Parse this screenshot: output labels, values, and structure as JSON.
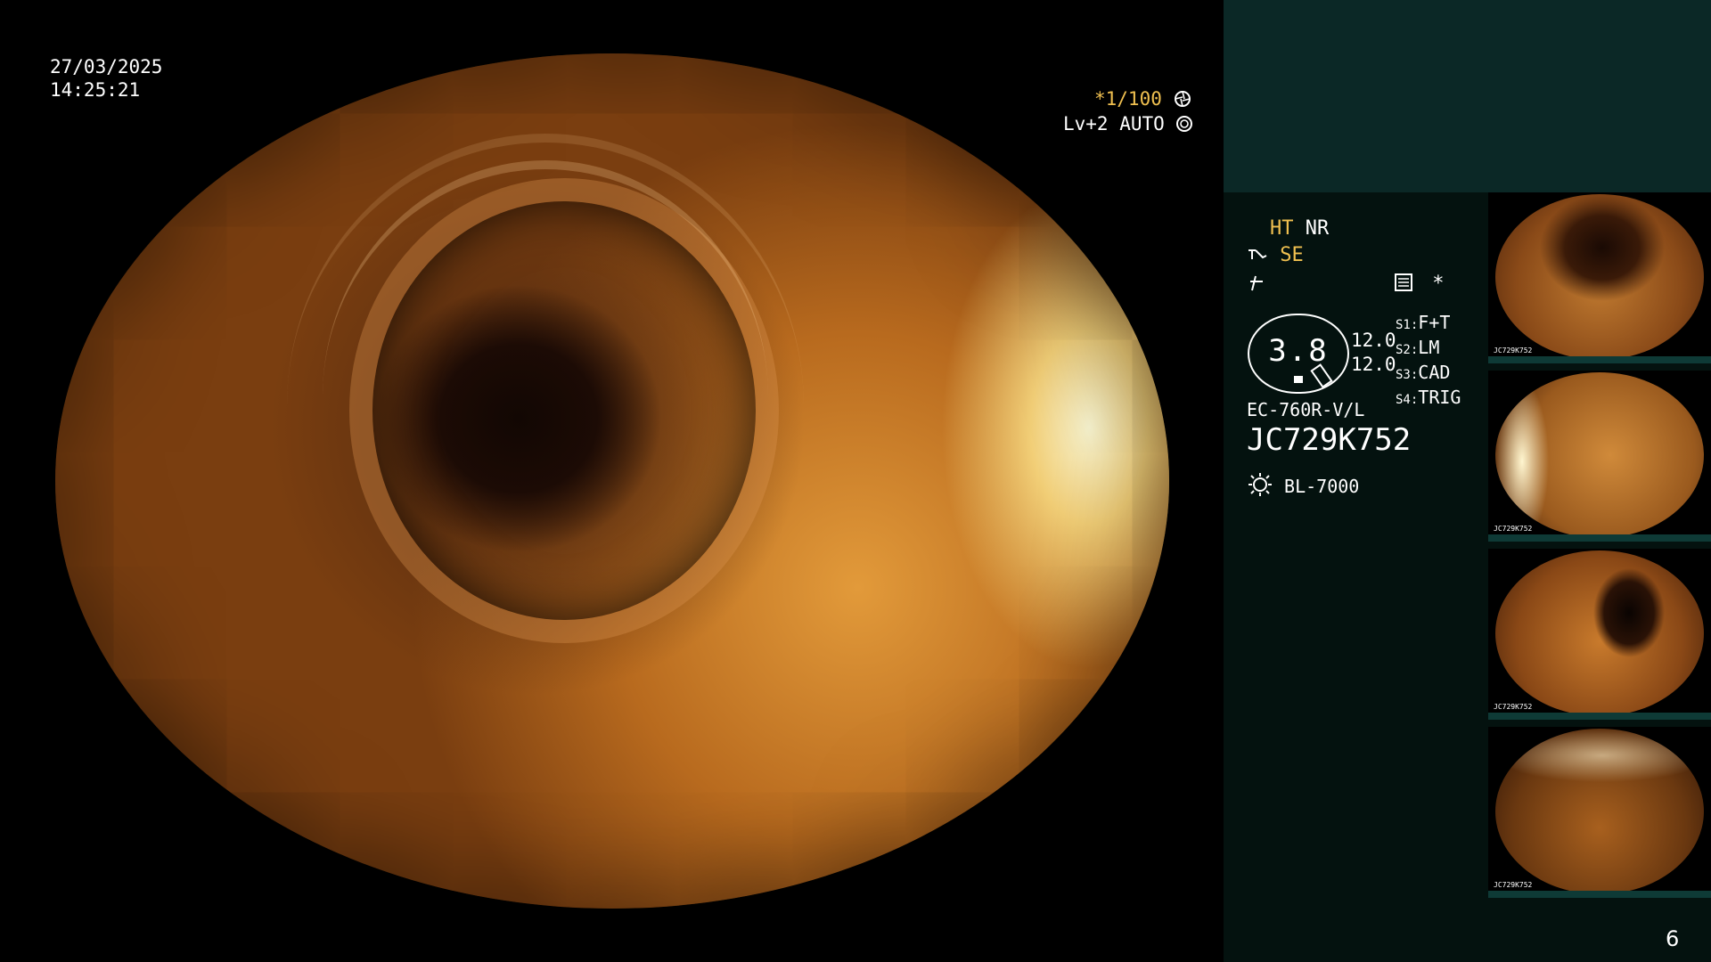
{
  "osd": {
    "date": "27/03/2025",
    "time": "14:25:21",
    "shutter": "*1/100",
    "iris": "Lv+2 AUTO"
  },
  "panel": {
    "ht": "HT",
    "nr": "NR",
    "se": "SE",
    "gauge_value": "3.8",
    "gauge_left_top": "12.0",
    "gauge_left_bottom": "12.0",
    "switches": [
      {
        "key": "S1",
        "value": "F+T"
      },
      {
        "key": "S2",
        "value": "LM"
      },
      {
        "key": "S3",
        "value": "CAD"
      },
      {
        "key": "S4",
        "value": "TRIG"
      }
    ],
    "scope_model": "EC-760R-V/L",
    "scope_serial": "JC729K752",
    "light_source": "BL-7000",
    "asterisk": "*",
    "page_number": "6"
  },
  "thumbnails": [
    {
      "caption": "JC729K752"
    },
    {
      "caption": "JC729K752"
    },
    {
      "caption": "JC729K752"
    },
    {
      "caption": "JC729K752"
    }
  ],
  "colors": {
    "panel_bg": "#04120f",
    "panel_top_bg": "#0b2826",
    "accent_yellow": "#f0c050",
    "thumb_bar": "#0e3a36"
  }
}
